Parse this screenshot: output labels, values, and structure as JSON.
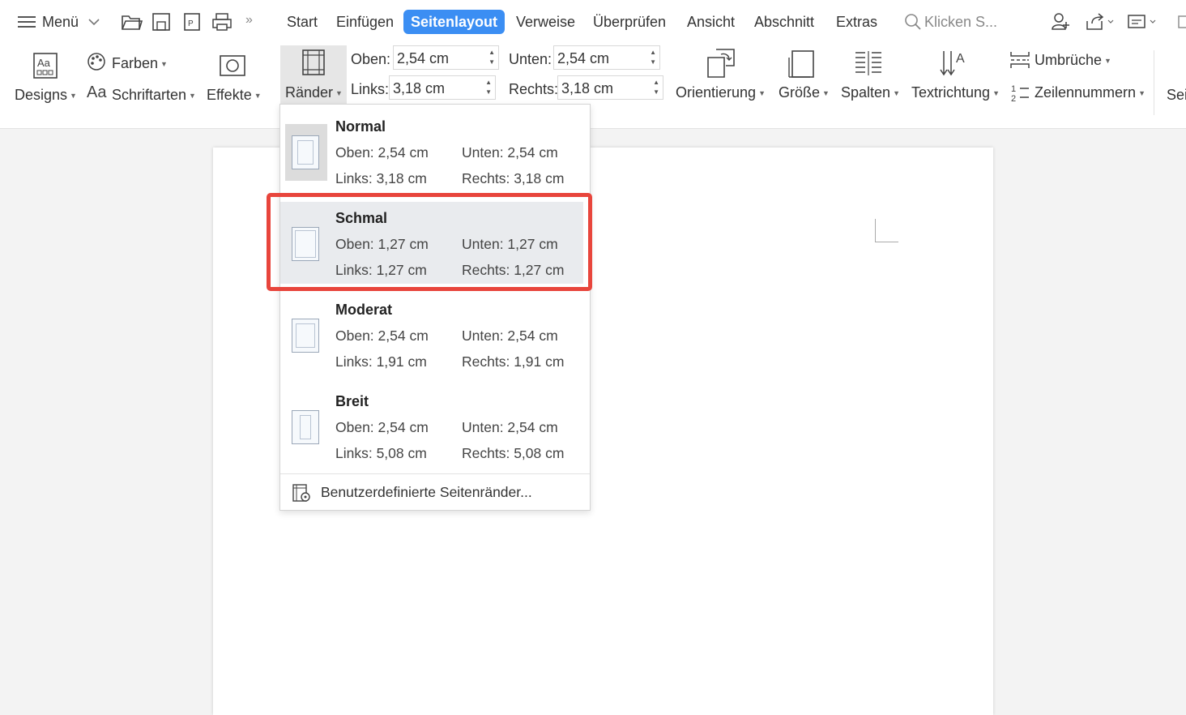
{
  "topbar": {
    "menu_label": "Menü",
    "tabs": [
      "Start",
      "Einfügen",
      "Seitenlayout",
      "Verweise",
      "Überprüfen",
      "Ansicht",
      "Abschnitt",
      "Extras"
    ],
    "active_tab": "Seitenlayout",
    "search_placeholder": "Klicken S..."
  },
  "ribbon": {
    "designs": "Designs",
    "farben": "Farben",
    "schriftarten": "Schriftarten",
    "effekte": "Effekte",
    "raender": "Ränder",
    "oben_label": "Oben:",
    "oben_value": "2,54 cm",
    "unten_label": "Unten:",
    "unten_value": "2,54 cm",
    "links_label": "Links:",
    "links_value": "3,18 cm",
    "rechts_label": "Rechts:",
    "rechts_value": "3,18 cm",
    "orientierung": "Orientierung",
    "groesse": "Größe",
    "spalten": "Spalten",
    "textrichtung": "Textrichtung",
    "umbrueche": "Umbrüche",
    "zeilennummern": "Zeilennummern",
    "seite_partial": "Sei"
  },
  "margins_menu": {
    "options": [
      {
        "title": "Normal",
        "oben": "Oben: 2,54 cm",
        "unten": "Unten: 2,54 cm",
        "links": "Links: 3,18 cm",
        "rechts": "Rechts: 3,18 cm"
      },
      {
        "title": "Schmal",
        "oben": "Oben: 1,27 cm",
        "unten": "Unten: 1,27 cm",
        "links": "Links: 1,27 cm",
        "rechts": "Rechts: 1,27 cm"
      },
      {
        "title": "Moderat",
        "oben": "Oben: 2,54 cm",
        "unten": "Unten: 2,54 cm",
        "links": "Links: 1,91 cm",
        "rechts": "Rechts: 1,91 cm"
      },
      {
        "title": "Breit",
        "oben": "Oben: 2,54 cm",
        "unten": "Unten: 2,54 cm",
        "links": "Links: 5,08 cm",
        "rechts": "Rechts: 5,08 cm"
      }
    ],
    "selected": "Schmal",
    "custom": "Benutzerdefinierte Seitenränder..."
  },
  "colors": {
    "accent": "#3b8ef3",
    "highlight": "#e8453c"
  }
}
